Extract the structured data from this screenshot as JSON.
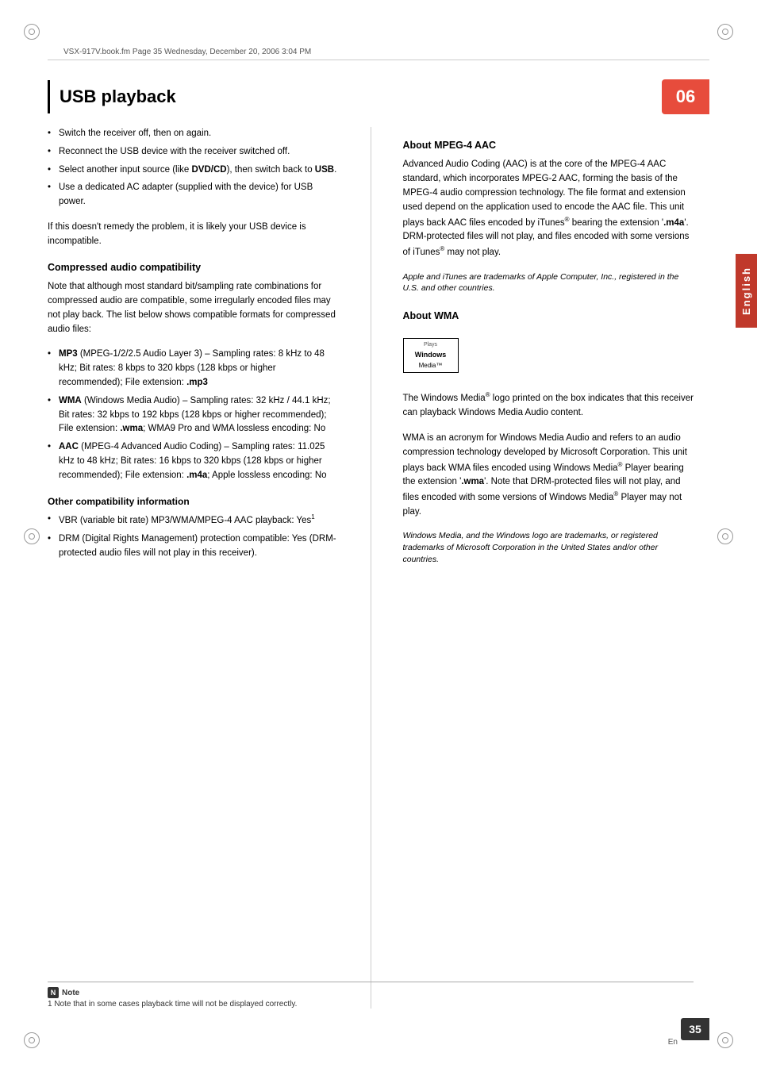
{
  "header": {
    "file_info": "VSX-917V.book.fm  Page 35  Wednesday, December 20, 2006  3:04 PM"
  },
  "page": {
    "title": "USB playback",
    "chapter": "06",
    "page_number": "35",
    "page_number_en": "En",
    "language_tab": "English"
  },
  "left_col": {
    "bullets_intro": [
      "Switch the receiver off, then on again.",
      "Reconnect the USB device with the receiver switched off.",
      "Select another input source (like DVD/CD), then switch back to USB.",
      "Use a dedicated AC adapter (supplied with the device) for USB power."
    ],
    "intro_text": "If this doesn't remedy the problem, it is likely your USB device is incompatible.",
    "compressed_heading": "Compressed audio compatibility",
    "compressed_intro": "Note that although most standard bit/sampling rate combinations for compressed audio are compatible, some irregularly encoded files may not play back. The list below shows compatible formats for compressed audio files:",
    "formats": [
      {
        "name": "MP3",
        "detail": "(MPEG-1/2/2.5 Audio Layer 3) – Sampling rates: 8 kHz to 48 kHz; Bit rates: 8 kbps to 320 kbps (128 kbps or higher recommended); File extension: .mp3"
      },
      {
        "name": "WMA",
        "detail": "(Windows Media Audio) – Sampling rates: 32 kHz / 44.1 kHz; Bit rates: 32 kbps to 192 kbps (128 kbps or higher recommended); File extension: .wma; WMA9 Pro and WMA lossless encoding: No"
      },
      {
        "name": "AAC",
        "detail": "(MPEG-4 Advanced Audio Coding) – Sampling rates: 11.025 kHz to 48 kHz; Bit rates: 16 kbps to 320 kbps (128 kbps or higher recommended); File extension: .m4a; Apple lossless encoding: No"
      }
    ],
    "other_heading": "Other compatibility information",
    "other_bullets": [
      "VBR (variable bit rate) MP3/WMA/MPEG-4 AAC playback: Yes¹",
      "DRM (Digital Rights Management) protection compatible: Yes (DRM-protected audio files will not play in this receiver)."
    ]
  },
  "right_col": {
    "mpeg4_heading": "About MPEG-4 AAC",
    "mpeg4_text": "Advanced Audio Coding (AAC) is at the core of the MPEG-4 AAC standard, which incorporates MPEG-2 AAC, forming the basis of the MPEG-4 audio compression technology. The file format and extension used depend on the application used to encode the AAC file. This unit plays back AAC files encoded by iTunes® bearing the extension '.m4a'. DRM-protected files will not play, and files encoded with some versions of iTunes® may not play.",
    "mpeg4_italic": "Apple and iTunes are trademarks of Apple Computer, Inc., registered in the U.S. and other countries.",
    "wma_heading": "About WMA",
    "wma_logo": {
      "plays": "Plays",
      "windows": "Windows",
      "media": "Media™"
    },
    "wma_text1": "The Windows Media® logo printed on the box indicates that this receiver can playback Windows Media Audio content.",
    "wma_text2": "WMA is an acronym for Windows Media Audio and refers to an audio compression technology developed by Microsoft Corporation. This unit plays back WMA files encoded using Windows Media® Player bearing the extension '.wma'. Note that DRM-protected files will not play, and files encoded with some versions of Windows Media® Player may not play.",
    "wma_italic": "Windows Media, and the Windows logo are trademarks, or registered trademarks of Microsoft Corporation in the United States and/or other countries."
  },
  "note": {
    "label": "Note",
    "text": "1  Note that in some cases playback time will not be displayed correctly."
  }
}
